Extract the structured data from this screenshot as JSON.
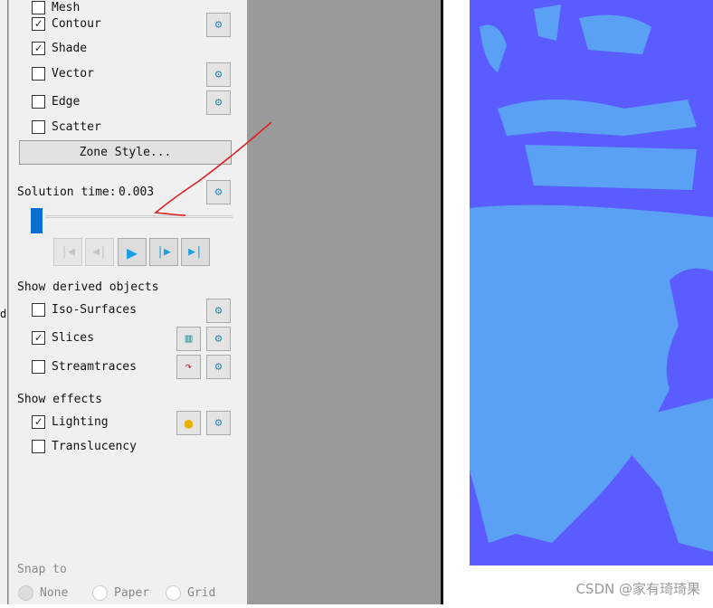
{
  "panel": {
    "zone_items": [
      {
        "label": "Mesh",
        "checked": false
      },
      {
        "label": "Contour",
        "checked": true
      },
      {
        "label": "Shade",
        "checked": true
      },
      {
        "label": "Vector",
        "checked": false
      },
      {
        "label": "Edge",
        "checked": false
      },
      {
        "label": "Scatter",
        "checked": false
      }
    ],
    "zone_style_button": "Zone Style...",
    "solution_time_label": "Solution time:",
    "solution_time_value": "0.003",
    "time_slider_fraction": 0.0,
    "derived_title": "Show derived objects",
    "derived_items": [
      {
        "label": "Iso-Surfaces",
        "checked": false
      },
      {
        "label": "Slices",
        "checked": true
      },
      {
        "label": "Streamtraces",
        "checked": false
      }
    ],
    "effects_title": "Show effects",
    "effects_items": [
      {
        "label": "Lighting",
        "checked": true
      },
      {
        "label": "Translucency",
        "checked": false
      }
    ],
    "snap_title": "Snap to",
    "snap_options": [
      "None",
      "Paper",
      "Grid"
    ],
    "snap_selected": "None"
  },
  "left_strip_text": "d",
  "colors": {
    "contour_dark": "#5a5cff",
    "contour_light": "#5aa0f5",
    "annotation": "#e02020",
    "slider": "#0a6ed1"
  },
  "watermark": "CSDN @家有琦琦果"
}
